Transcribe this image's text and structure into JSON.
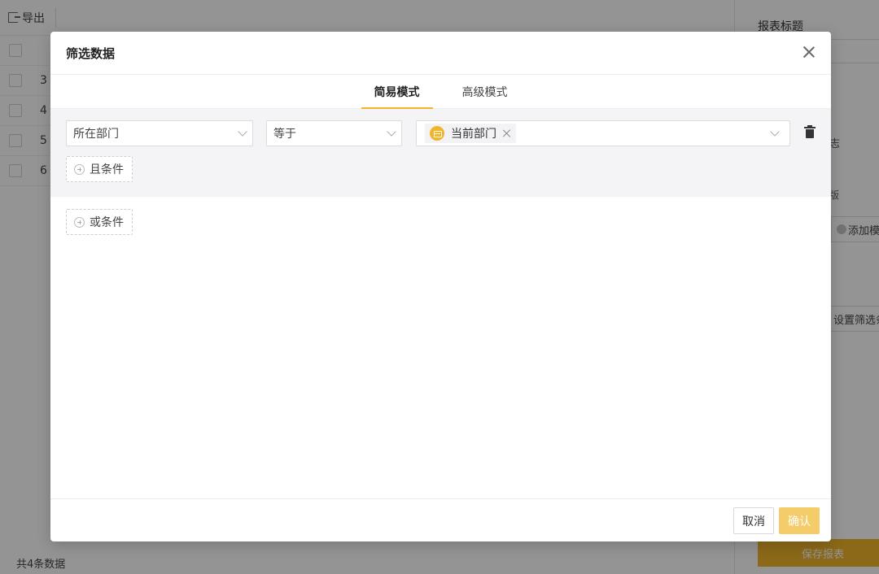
{
  "background": {
    "toolbar": {
      "export_label": "导出"
    },
    "row_numbers": [
      "3",
      "4",
      "5",
      "6"
    ],
    "footer_count": "共4条数据",
    "right_panel": {
      "report_title_label": "报表标题",
      "log_label": "志",
      "version_label": "版",
      "add_template_label": "添加模",
      "set_filter_label": "设置筛选条",
      "save_label": "保存报表"
    }
  },
  "modal": {
    "title": "筛选数据",
    "tabs": [
      {
        "label": "简易模式",
        "active": true
      },
      {
        "label": "高级模式",
        "active": false
      }
    ],
    "condition": {
      "field": "所在部门",
      "operator": "等于",
      "value_tag": "当前部门"
    },
    "and_condition_label": "且条件",
    "or_condition_label": "或条件",
    "footer": {
      "cancel_label": "取消",
      "confirm_label": "确认"
    }
  },
  "colors": {
    "accent": "#f0b52b",
    "confirm_button": "#f4cd6a",
    "condition_bg": "#f4f4f6"
  },
  "icons": [
    "export-icon",
    "close-icon",
    "chevron-down-icon",
    "department-icon",
    "tag-remove-icon",
    "trash-icon",
    "plus-circle-icon"
  ]
}
